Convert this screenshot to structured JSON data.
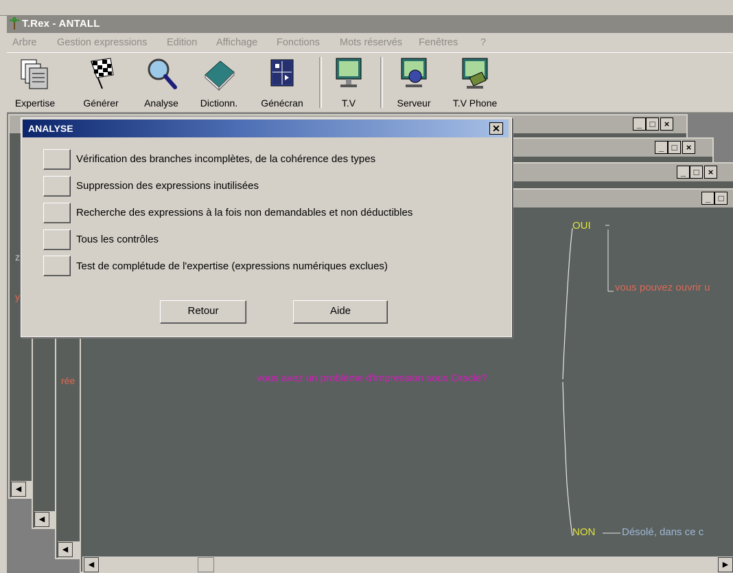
{
  "app": {
    "title": "T.Rex - ANTALL"
  },
  "menu": [
    "Arbre",
    "Gestion expressions",
    "Edition",
    "Affichage",
    "Fonctions",
    "Mots réservés",
    "Fenêtres",
    "?"
  ],
  "toolbar": [
    {
      "label": "Expertise",
      "icon": "documents-stack-icon"
    },
    {
      "label": "Générer",
      "icon": "checkered-flag-icon"
    },
    {
      "label": "Analyse",
      "icon": "magnifier-icon"
    },
    {
      "label": "Dictionn.",
      "icon": "book-icon"
    },
    {
      "label": "Génécran",
      "icon": "screen-layout-icon"
    },
    {
      "label": "T.V",
      "icon": "monitor-icon"
    },
    {
      "label": "Serveur",
      "icon": "server-monitor-icon"
    },
    {
      "label": "T.V Phone",
      "icon": "phone-monitor-icon"
    }
  ],
  "dialog": {
    "title": "ANALYSE",
    "close": "✕",
    "options": [
      "Vérification des branches incomplètes, de la cohérence des types",
      "Suppression des expressions inutilisées",
      "Recherche des expressions à la fois non demandables et non déductibles",
      "Tous les contrôles",
      "Test de complétude de l'expertise (expressions numériques exclues)"
    ],
    "buttons": {
      "return": "Retour",
      "help": "Aide"
    }
  },
  "tree": {
    "root": "vous avez un problème d'impression sous Oracle?",
    "yes": "OUI",
    "yes_child": "vous pouvez ouvrir u",
    "no": "NON",
    "no_child": "Désolé, dans ce c",
    "left_fragments": {
      "z": "z",
      "y": "y",
      "ree": "rée"
    }
  },
  "colors": {
    "tree_bg": "#59605d",
    "root_text": "#d21dbd",
    "branch_label": "#e4e43c",
    "yes_child_text": "#d96a5a",
    "no_child_text": "#9fb6d6"
  }
}
